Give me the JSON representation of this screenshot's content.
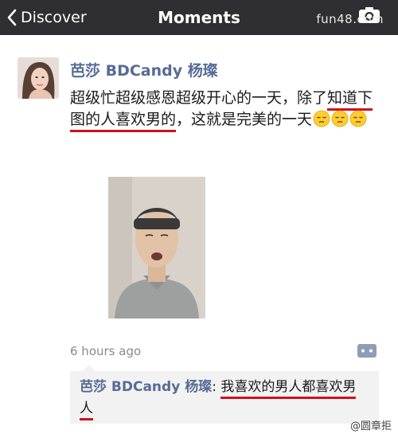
{
  "navbar": {
    "back_label": "Discover",
    "title": "Moments",
    "watermark": "fun48.com"
  },
  "post": {
    "author": "芭莎 BDCandy 杨璨",
    "text_part1": "超级忙超级感恩超级开心的一天，除了",
    "text_underlined": "知道下图的人喜欢男的",
    "text_part2": "，这就是完美的一天",
    "emojis": [
      "pensive-face-icon",
      "pensive-face-icon",
      "pensive-face-icon"
    ],
    "timestamp": "6 hours ago"
  },
  "comment": {
    "author": "芭莎 BDCandy 杨璨",
    "separator": ": ",
    "text": "我喜欢的男人都喜欢男人"
  },
  "watermark_bottom": "@圆章拒",
  "colors": {
    "navbar_bg": "#2f2f33",
    "link_blue": "#576b95",
    "underline_red": "#d10f1c",
    "timestamp_gray": "#8a8a8a",
    "comment_bg": "#f2f2f2"
  }
}
